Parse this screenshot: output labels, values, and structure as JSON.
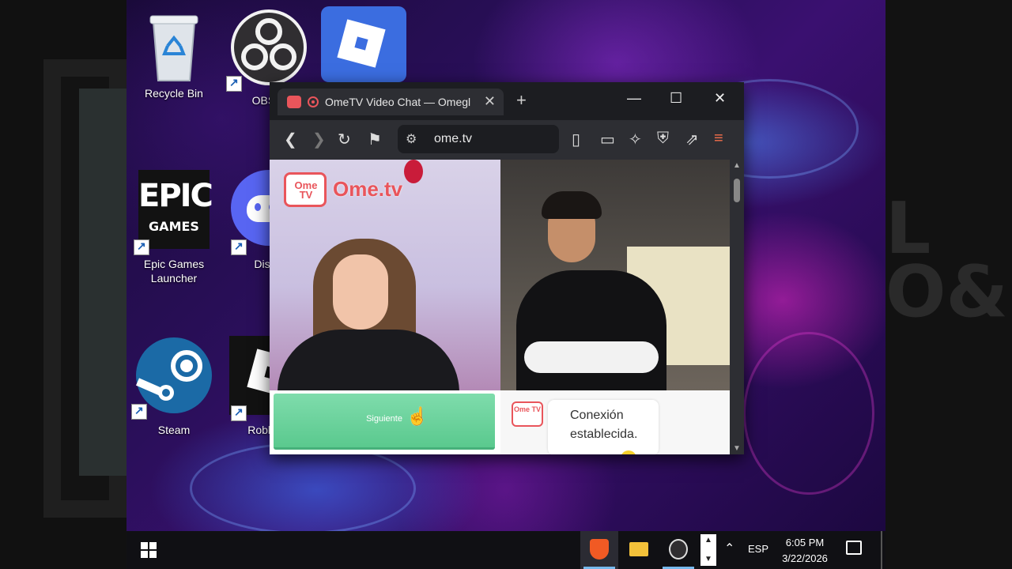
{
  "desktop": {
    "icons": [
      {
        "label": "Recycle Bin"
      },
      {
        "label": "OBS S"
      },
      {
        "label": ""
      },
      {
        "label": "Epic Games Launcher",
        "logo_text": "EPIC",
        "logo_sub": "GAMES"
      },
      {
        "label": "Disc"
      },
      {
        "label": "Steam"
      },
      {
        "label": "Roblox"
      }
    ]
  },
  "browser": {
    "tab_title": "OmeTV Video Chat — Omegl",
    "tab_close": "✕",
    "new_tab": "+",
    "url": "ome.tv",
    "window_controls": {
      "minimize": "—",
      "maximize": "☐",
      "close": "✕"
    }
  },
  "site": {
    "logo_tv_text": "Ome TV",
    "logo_brand": "Ome.tv",
    "next_button": "Siguiente",
    "chat_message": "Conexión establecida.",
    "accent_color": "#e9555b",
    "button_color": "#6fd39f"
  },
  "taskbar": {
    "language": "ESP",
    "time": "6:05 PM",
    "date": "3/22/2026"
  }
}
